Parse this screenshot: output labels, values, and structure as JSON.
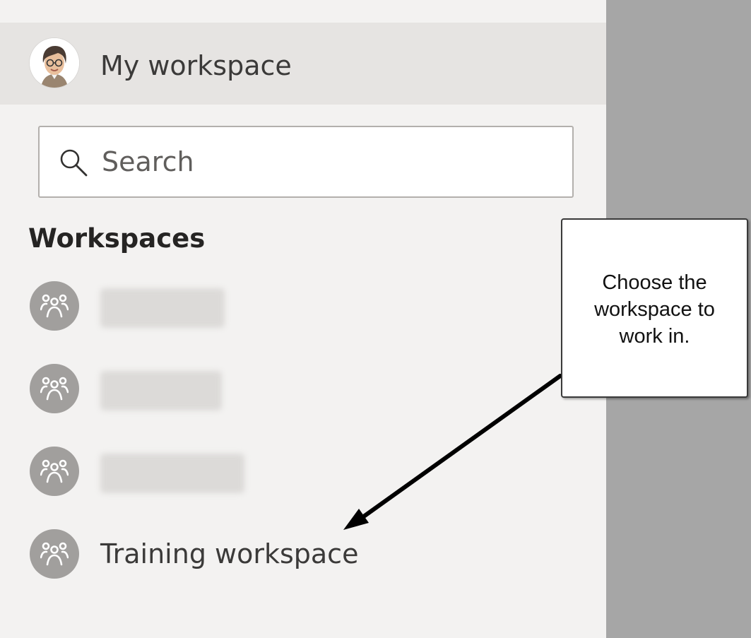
{
  "my_workspace": {
    "label": "My workspace",
    "avatar_icon": "user-avatar"
  },
  "search": {
    "placeholder": "Search",
    "value": "",
    "icon": "search-icon"
  },
  "workspaces": {
    "heading": "Workspaces",
    "items": [
      {
        "label": "",
        "icon": "group-icon",
        "blurred": true
      },
      {
        "label": "",
        "icon": "group-icon",
        "blurred": true
      },
      {
        "label": "",
        "icon": "group-icon",
        "blurred": true
      },
      {
        "label": "Training workspace",
        "icon": "group-icon",
        "blurred": false
      }
    ]
  },
  "callout": {
    "text": "Choose the workspace to work in."
  },
  "colors": {
    "panel_background": "#f3f2f1",
    "selected_row": "#e6e4e2",
    "outer_background": "#a6a6a6",
    "workspace_icon_circle": "#a19f9d",
    "arrow": "#000000"
  }
}
